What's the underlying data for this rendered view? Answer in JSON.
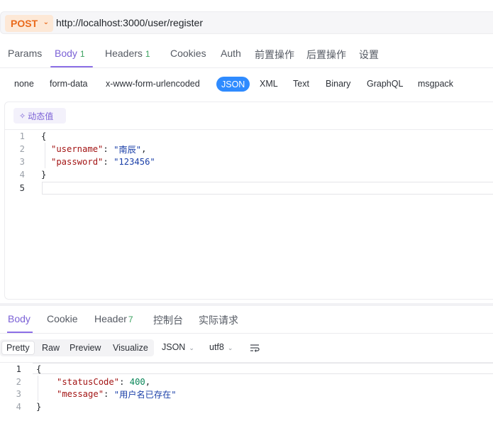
{
  "request": {
    "method": "POST",
    "url": "http://localhost:3000/user/register"
  },
  "request_tabs": [
    {
      "label": "Params",
      "count": ""
    },
    {
      "label": "Body",
      "count": "1"
    },
    {
      "label": "Headers",
      "count": "1"
    },
    {
      "label": "Cookies",
      "count": ""
    },
    {
      "label": "Auth",
      "count": ""
    },
    {
      "label": "前置操作",
      "count": ""
    },
    {
      "label": "后置操作",
      "count": ""
    },
    {
      "label": "设置",
      "count": ""
    }
  ],
  "body_types": [
    "none",
    "form-data",
    "x-www-form-urlencoded",
    "JSON",
    "XML",
    "Text",
    "Binary",
    "GraphQL",
    "msgpack"
  ],
  "body_type_selected": "JSON",
  "dynamic_value_label": "动态值",
  "editor": {
    "line_numbers": [
      "1",
      "2",
      "3",
      "4",
      "5"
    ],
    "lines": [
      {
        "open": "{"
      },
      {
        "key": "\"username\"",
        "sep": ": ",
        "value": "\"南辰\"",
        "end": ","
      },
      {
        "key": "\"password\"",
        "sep": ": ",
        "value": "\"123456\"",
        "end": ""
      },
      {
        "close": "}"
      }
    ]
  },
  "response_tabs": [
    {
      "label": "Body",
      "count": ""
    },
    {
      "label": "Cookie",
      "count": ""
    },
    {
      "label": "Header",
      "count": "7"
    },
    {
      "label": "控制台",
      "count": ""
    },
    {
      "label": "实际请求",
      "count": ""
    }
  ],
  "response_views": [
    "Pretty",
    "Raw",
    "Preview",
    "Visualize"
  ],
  "response_format": "JSON",
  "response_encoding": "utf8",
  "response": {
    "line_numbers": [
      "1",
      "2",
      "3",
      "4"
    ],
    "open": "{",
    "status_key": "\"statusCode\"",
    "status_value": "400",
    "message_key": "\"message\"",
    "message_value": "\"用户名已存在\"",
    "close": "}"
  },
  "colors": {
    "method": "#ea6a1b",
    "accent": "#7b61d6",
    "selected_type": "#2f8bff",
    "json_key": "#a31515",
    "json_string": "#1a3fa8",
    "json_number": "#098658"
  }
}
